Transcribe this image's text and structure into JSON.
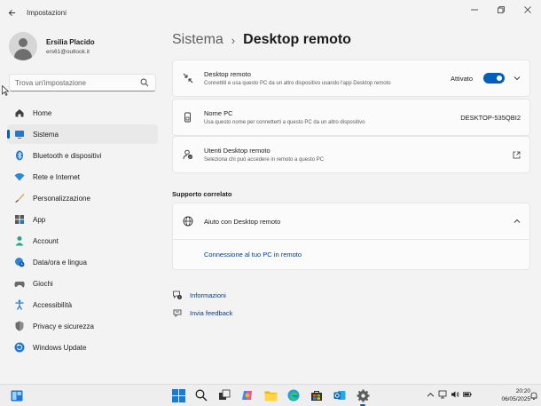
{
  "window": {
    "title": "Impostazioni"
  },
  "profile": {
    "name": "Ersilia Placido",
    "email": "ers61@outlook.it"
  },
  "search": {
    "placeholder": "Trova un'impostazione",
    "value": ""
  },
  "sidebar": {
    "items": [
      {
        "label": "Home",
        "icon": "home-icon",
        "active": false
      },
      {
        "label": "Sistema",
        "icon": "system-icon",
        "active": true
      },
      {
        "label": "Bluetooth e dispositivi",
        "icon": "bluetooth-icon",
        "active": false
      },
      {
        "label": "Rete e Internet",
        "icon": "wifi-icon",
        "active": false
      },
      {
        "label": "Personalizzazione",
        "icon": "brush-icon",
        "active": false
      },
      {
        "label": "App",
        "icon": "apps-icon",
        "active": false
      },
      {
        "label": "Account",
        "icon": "account-icon",
        "active": false
      },
      {
        "label": "Data/ora e lingua",
        "icon": "globe-clock-icon",
        "active": false
      },
      {
        "label": "Giochi",
        "icon": "gamepad-icon",
        "active": false
      },
      {
        "label": "Accessibilità",
        "icon": "accessibility-icon",
        "active": false
      },
      {
        "label": "Privacy e sicurezza",
        "icon": "shield-icon",
        "active": false
      },
      {
        "label": "Windows Update",
        "icon": "update-icon",
        "active": false
      }
    ]
  },
  "breadcrumb": {
    "parent": "Sistema",
    "separator": "›",
    "current": "Desktop remoto"
  },
  "cards": {
    "remote_desktop": {
      "title": "Desktop remoto",
      "description": "Connettiti e usa questo PC da un altro dispositivo usando l'app Desktop remoto",
      "status": "Attivato",
      "enabled": true
    },
    "pc_name": {
      "title": "Nome PC",
      "description": "Usa questo nome per connetterti a questo PC da un altro dispositivo",
      "value": "DESKTOP-535QBI2"
    },
    "users": {
      "title": "Utenti Desktop remoto",
      "description": "Seleziona chi può accedere in remoto a questo PC"
    }
  },
  "related": {
    "section_title": "Supporto correlato",
    "help_title": "Aiuto con Desktop remoto",
    "link": "Connessione al tuo PC in remoto"
  },
  "footer": {
    "info": "Informazioni",
    "feedback": "Invia feedback"
  },
  "taskbar": {
    "time": "20:20",
    "date": "06/05/2025"
  },
  "colors": {
    "accent": "#005fb8",
    "link": "#003e92",
    "background": "#f3f3f3",
    "card": "#fbfbfb"
  }
}
